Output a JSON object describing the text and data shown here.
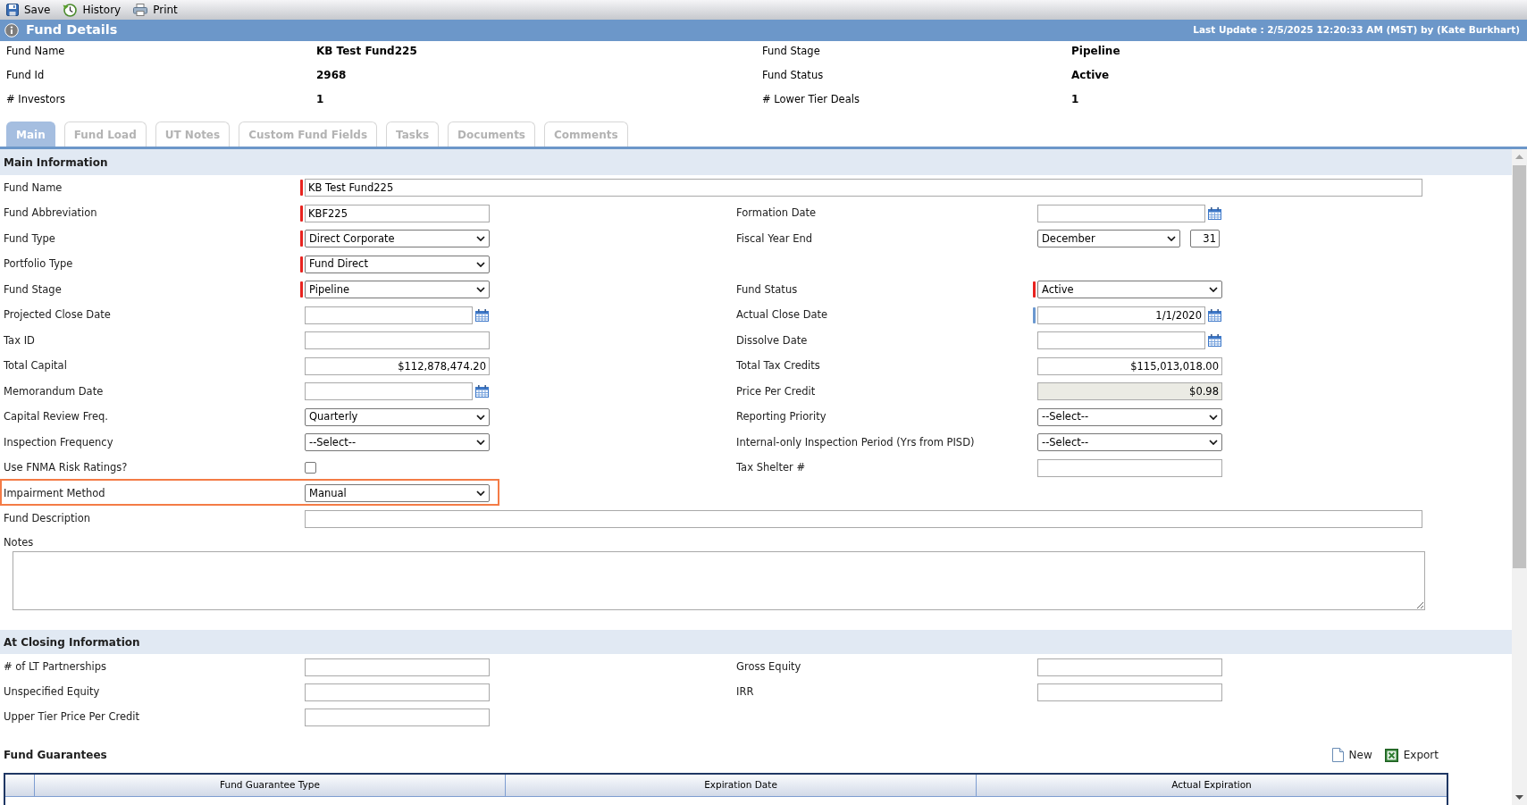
{
  "toolbar": [
    {
      "kind": "save",
      "label": "Save"
    },
    {
      "kind": "history",
      "label": "History"
    },
    {
      "kind": "print",
      "label": "Print"
    }
  ],
  "header": {
    "title": "Fund Details",
    "last_update": "Last Update : 2/5/2025 12:20:33 AM (MST) by (Kate Burkhart)"
  },
  "summary": [
    {
      "label": "Fund Name",
      "value": "KB Test Fund225"
    },
    {
      "label": "Fund Stage",
      "value": "Pipeline"
    },
    {
      "label": "Fund Id",
      "value": "2968"
    },
    {
      "label": "Fund Status",
      "value": "Active"
    },
    {
      "label": "# Investors",
      "value": "1"
    },
    {
      "label": "# Lower Tier Deals",
      "value": "1"
    }
  ],
  "tabs": [
    {
      "label": "Main",
      "selected": true
    },
    {
      "label": "Fund Load",
      "selected": false
    },
    {
      "label": "UT Notes",
      "selected": false
    },
    {
      "label": "Custom Fund Fields",
      "selected": false
    },
    {
      "label": "Tasks",
      "selected": false
    },
    {
      "label": "Documents",
      "selected": false
    },
    {
      "label": "Comments",
      "selected": false
    }
  ],
  "main_information": {
    "title": "Main Information",
    "rows": [
      {
        "highlighted": false,
        "fields": [
          {
            "label": "Fund Name",
            "kind": "wide_text",
            "value": "KB Test Fund225",
            "color": "#e8231f"
          }
        ]
      },
      {
        "highlighted": false,
        "fields": [
          {
            "label": "Fund Abbreviation",
            "kind": "text",
            "value": "KBF225",
            "color": "#e8231f"
          },
          {
            "label": "Formation Date",
            "kind": "date"
          }
        ]
      },
      {
        "highlighted": false,
        "fields": [
          {
            "label": "Fund Type",
            "kind": "select",
            "value": "Direct Corporate",
            "color": "#e8231f"
          },
          {
            "label": "Fiscal Year End",
            "kind": "month_day",
            "value": "December",
            "day": "31"
          }
        ]
      },
      {
        "highlighted": false,
        "fields": [
          {
            "label": "Portfolio Type",
            "kind": "select",
            "value": "Fund Direct",
            "color": "#e8231f"
          }
        ]
      },
      {
        "highlighted": false,
        "fields": [
          {
            "label": "Fund Stage",
            "kind": "select",
            "value": "Pipeline",
            "color": "#e8231f"
          },
          {
            "label": "Fund Status",
            "kind": "select",
            "value": "Active",
            "color": "#e8231f"
          }
        ]
      },
      {
        "highlighted": false,
        "fields": [
          {
            "label": "Projected Close Date",
            "kind": "date"
          },
          {
            "label": "Actual Close Date",
            "kind": "date",
            "value": "1/1/2020",
            "color": "#6b98d0"
          }
        ]
      },
      {
        "highlighted": false,
        "fields": [
          {
            "label": "Tax ID",
            "kind": "text"
          },
          {
            "label": "Dissolve Date",
            "kind": "date"
          }
        ]
      },
      {
        "highlighted": false,
        "fields": [
          {
            "label": "Total Capital",
            "kind": "amount",
            "value": "$112,878,474.20"
          },
          {
            "label": "Total Tax Credits",
            "kind": "amount",
            "value": "$115,013,018.00"
          }
        ]
      },
      {
        "highlighted": false,
        "fields": [
          {
            "label": "Memorandum Date",
            "kind": "date"
          },
          {
            "label": "Price Per Credit",
            "kind": "readonly_amount",
            "value": "$0.98"
          }
        ]
      },
      {
        "highlighted": false,
        "fields": [
          {
            "label": "Capital Review Freq.",
            "kind": "select",
            "value": "Quarterly"
          },
          {
            "label": "Reporting Priority",
            "kind": "select",
            "value": "--Select--"
          }
        ]
      },
      {
        "highlighted": false,
        "fields": [
          {
            "label": "Inspection Frequency",
            "kind": "select",
            "value": "--Select--"
          },
          {
            "label": "Internal-only Inspection Period (Yrs from PISD)",
            "kind": "select",
            "value": "--Select--"
          }
        ]
      },
      {
        "highlighted": false,
        "fields": [
          {
            "label": "Use FNMA Risk Ratings?",
            "kind": "checkbox",
            "checked": false
          },
          {
            "label": "Tax Shelter #",
            "kind": "text"
          }
        ]
      },
      {
        "highlighted": true,
        "fields": [
          {
            "label": "Impairment Method",
            "kind": "select",
            "value": "Manual"
          }
        ]
      },
      {
        "highlighted": false,
        "fields": [
          {
            "label": "Fund Description",
            "kind": "wide_text"
          }
        ]
      },
      {
        "highlighted": false,
        "fields": [
          {
            "label": "Notes",
            "kind": "textarea"
          }
        ]
      }
    ]
  },
  "at_closing_information": {
    "title": "At Closing Information",
    "rows": [
      {
        "fields": [
          {
            "label": "# of LT Partnerships",
            "kind": "text"
          },
          {
            "label": "Gross Equity",
            "kind": "text"
          }
        ]
      },
      {
        "fields": [
          {
            "label": "Unspecified Equity",
            "kind": "text"
          },
          {
            "label": "IRR",
            "kind": "text"
          }
        ]
      },
      {
        "fields": [
          {
            "label": "Upper Tier Price Per Credit",
            "kind": "text"
          }
        ]
      }
    ]
  },
  "fund_guarantees": {
    "title": "Fund Guarantees",
    "actions": [
      {
        "kind": "new",
        "label": "New"
      },
      {
        "kind": "export",
        "label": "Export"
      }
    ],
    "columns": [
      "Fund Guarantee Type",
      "Expiration Date",
      "Actual Expiration"
    ]
  }
}
